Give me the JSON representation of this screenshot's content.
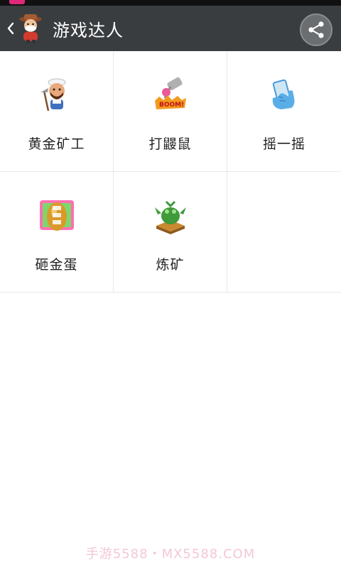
{
  "app_bar": {
    "title": "游戏达人",
    "back_icon": "chevron-left-icon",
    "logo_icon": "cowboy-mascot-icon",
    "share_icon": "share-icon",
    "background": "#3a3d40"
  },
  "games": [
    {
      "label": "黄金矿工",
      "icon": "gold-miner-icon"
    },
    {
      "label": "打鼹鼠",
      "icon": "whack-a-mole-icon"
    },
    {
      "label": "摇一摇",
      "icon": "shake-phone-icon"
    },
    {
      "label": "砸金蛋",
      "icon": "golden-egg-icon"
    },
    {
      "label": "炼矿",
      "icon": "smelting-cauldron-icon"
    }
  ],
  "watermark": "手游5588・MX5588.COM"
}
